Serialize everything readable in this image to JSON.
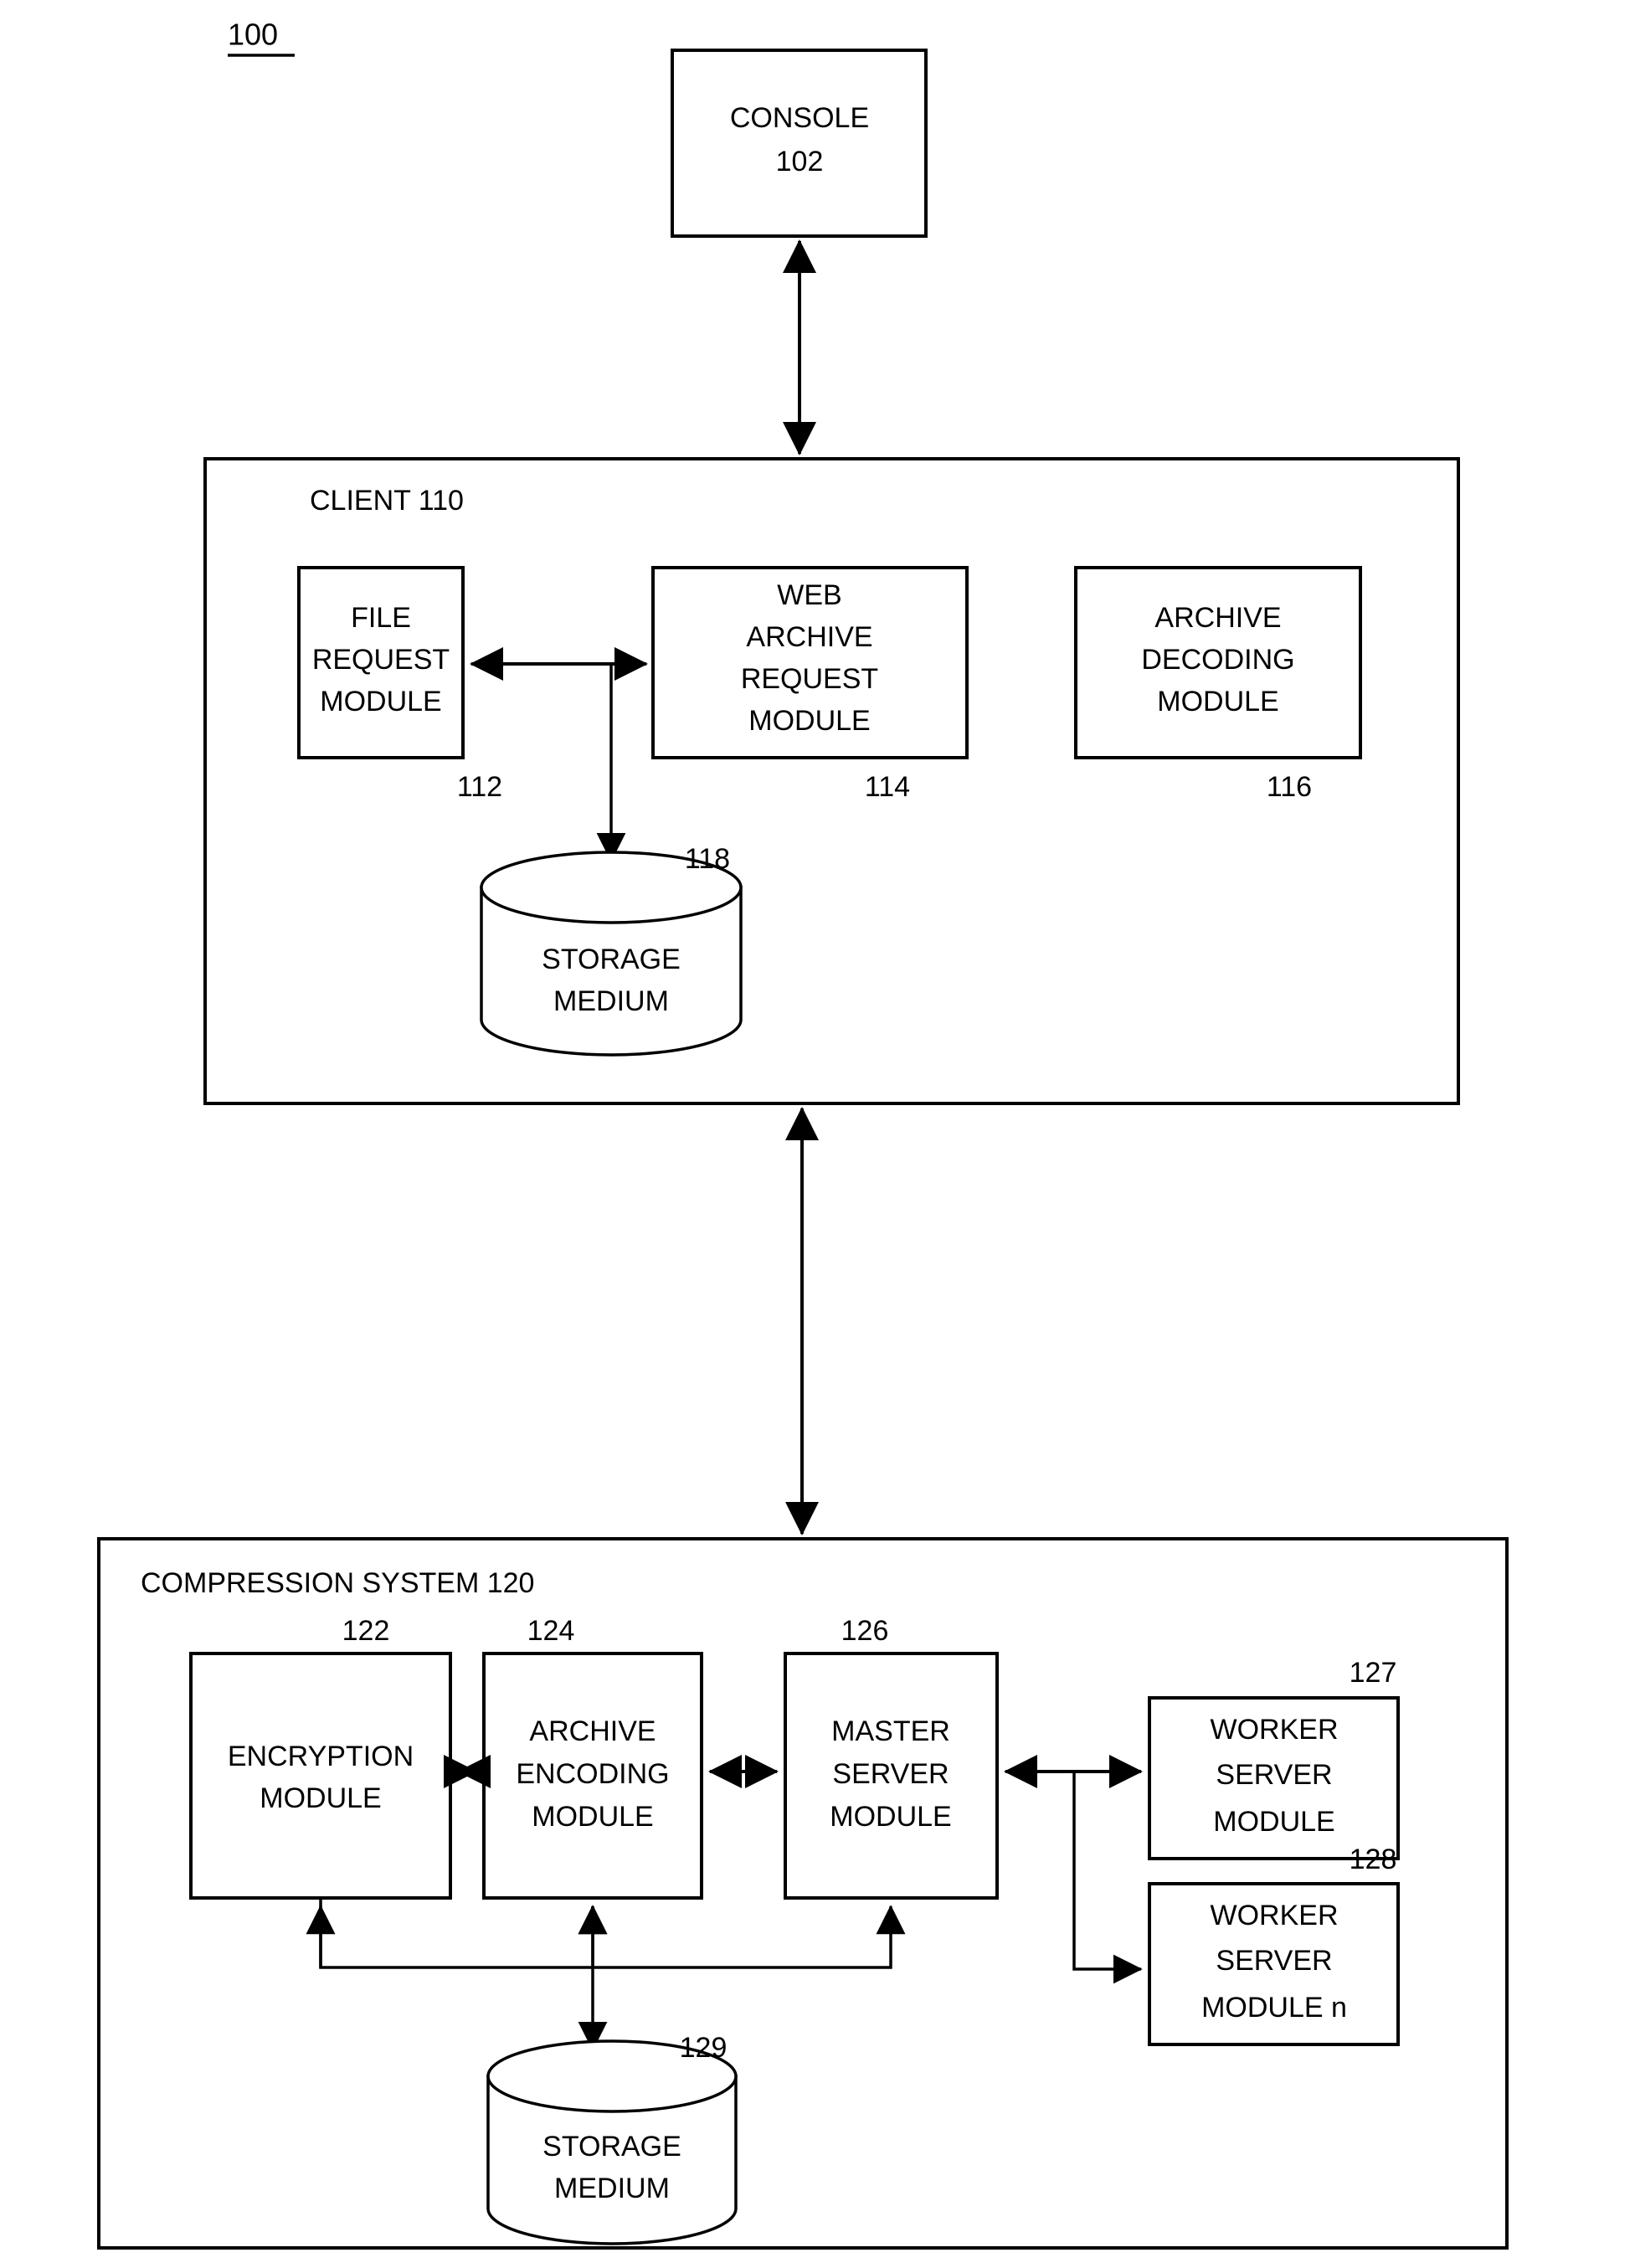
{
  "figure": {
    "label": "100"
  },
  "console": {
    "title": "CONSOLE",
    "ref": "102"
  },
  "client": {
    "header": "CLIENT 110",
    "modules": [
      {
        "name": "file-request-module",
        "lines": [
          "FILE",
          "REQUEST",
          "MODULE"
        ],
        "ref": "112"
      },
      {
        "name": "web-archive-request-module",
        "lines": [
          "WEB",
          "ARCHIVE",
          "REQUEST",
          "MODULE"
        ],
        "ref": "114"
      },
      {
        "name": "archive-decoding-module",
        "lines": [
          "ARCHIVE",
          "DECODING",
          "MODULE"
        ],
        "ref": "116"
      }
    ],
    "storage": {
      "lines": [
        "STORAGE",
        "MEDIUM"
      ],
      "ref": "118"
    }
  },
  "compression_system": {
    "header": "COMPRESSION SYSTEM 120",
    "modules": [
      {
        "name": "encryption-module",
        "lines": [
          "ENCRYPTION",
          "MODULE"
        ],
        "ref": "122"
      },
      {
        "name": "archive-encoding-module",
        "lines": [
          "ARCHIVE",
          "ENCODING",
          "MODULE"
        ],
        "ref": "124"
      },
      {
        "name": "master-server-module",
        "lines": [
          "MASTER",
          "SERVER",
          "MODULE"
        ],
        "ref": "126"
      },
      {
        "name": "worker-server-module",
        "lines": [
          "WORKER",
          "SERVER",
          "MODULE"
        ],
        "ref": "127"
      },
      {
        "name": "worker-server-module-n",
        "lines": [
          "WORKER",
          "SERVER",
          "MODULE n"
        ],
        "ref": "128"
      }
    ],
    "storage": {
      "lines": [
        "STORAGE",
        "MEDIUM"
      ],
      "ref": "129"
    }
  },
  "colors": {
    "ink": "#000000",
    "paper": "#ffffff"
  }
}
